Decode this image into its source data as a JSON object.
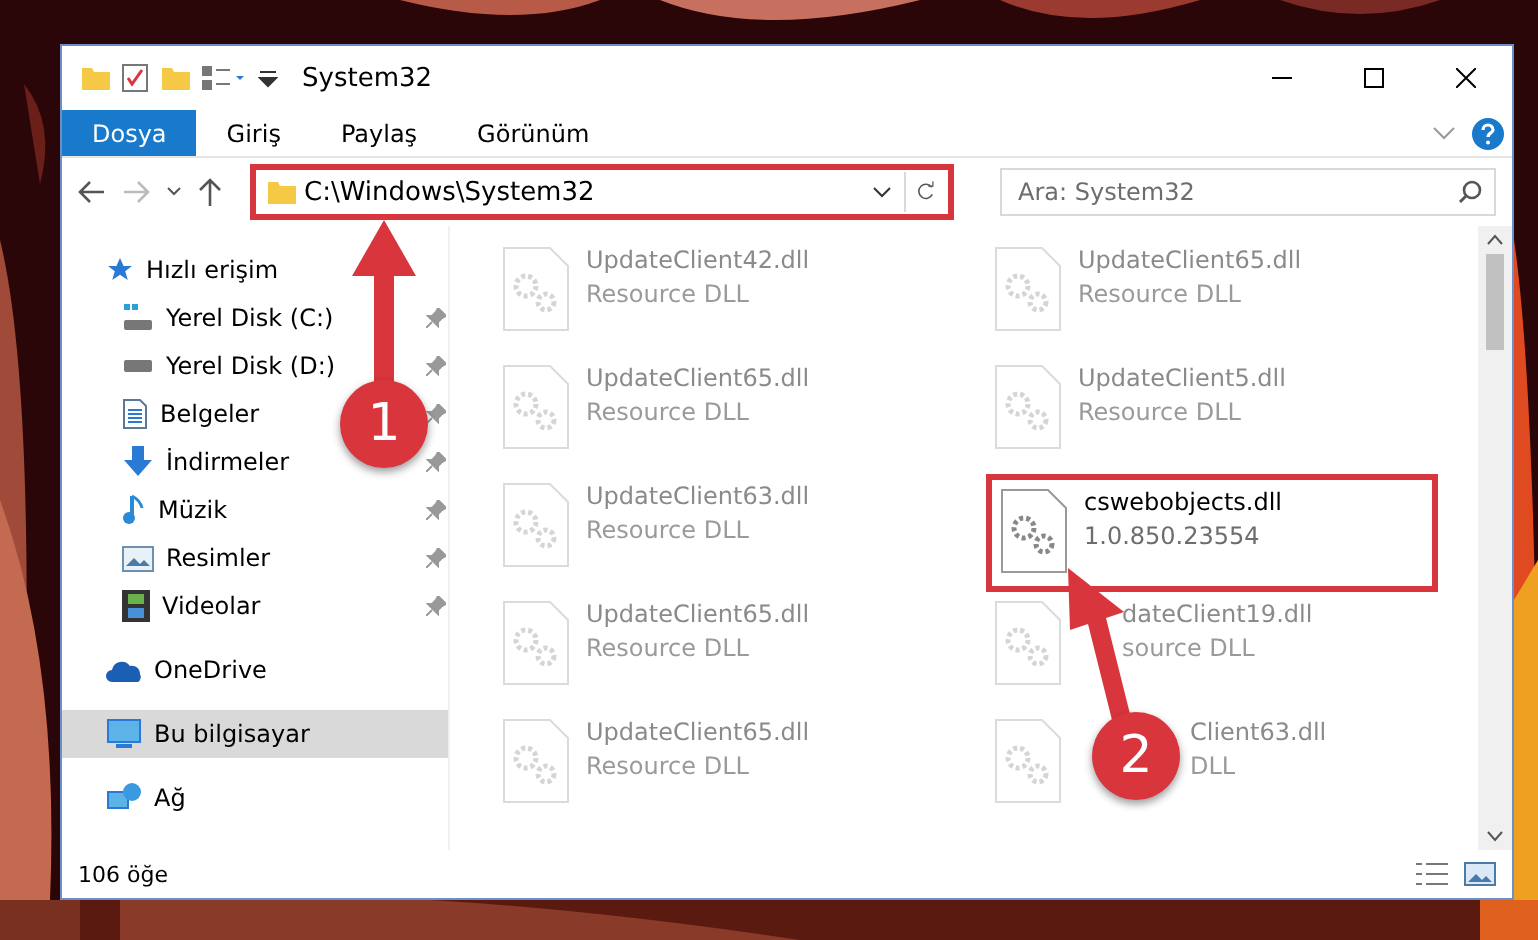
{
  "window": {
    "title": "System32"
  },
  "ribbon": {
    "tabs": [
      {
        "label": "Dosya",
        "selected": true
      },
      {
        "label": "Giriş",
        "selected": false
      },
      {
        "label": "Paylaş",
        "selected": false
      },
      {
        "label": "Görünüm",
        "selected": false
      }
    ]
  },
  "address": {
    "path": "C:\\Windows\\System32",
    "highlighted": true
  },
  "search": {
    "placeholder": "Ara: System32"
  },
  "sidebar": {
    "items": [
      {
        "label": "Hızlı erişim",
        "kind": "star",
        "selected": false,
        "children": [
          {
            "label": "Yerel Disk (C:)",
            "kind": "windisk",
            "pinned": true
          },
          {
            "label": "Yerel Disk (D:)",
            "kind": "disk",
            "pinned": true
          },
          {
            "label": "Belgeler",
            "kind": "doc",
            "pinned": true
          },
          {
            "label": "İndirmeler",
            "kind": "download",
            "pinned": true
          },
          {
            "label": "Müzik",
            "kind": "music",
            "pinned": true
          },
          {
            "label": "Resimler",
            "kind": "pictures",
            "pinned": true
          },
          {
            "label": "Videolar",
            "kind": "video",
            "pinned": true
          }
        ]
      },
      {
        "label": "OneDrive",
        "kind": "cloud",
        "selected": false
      },
      {
        "label": "Bu bilgisayar",
        "kind": "pc",
        "selected": true
      },
      {
        "label": "Ağ",
        "kind": "network",
        "selected": false
      }
    ]
  },
  "files": [
    {
      "name": "UpdateClient42.dll",
      "detail": "Resource DLL",
      "faded": true,
      "highlighted": false
    },
    {
      "name": "UpdateClient65.dll",
      "detail": "Resource DLL",
      "faded": true,
      "highlighted": false
    },
    {
      "name": "UpdateClient65.dll",
      "detail": "Resource DLL",
      "faded": true,
      "highlighted": false
    },
    {
      "name": "UpdateClient5.dll",
      "detail": "Resource DLL",
      "faded": true,
      "highlighted": false
    },
    {
      "name": "UpdateClient63.dll",
      "detail": "Resource DLL",
      "faded": true,
      "highlighted": false
    },
    {
      "name": "cswebobjects.dll",
      "detail": "1.0.850.23554",
      "faded": false,
      "highlighted": true
    },
    {
      "name": "UpdateClient65.dll",
      "detail": "Resource DLL",
      "faded": true,
      "highlighted": false
    },
    {
      "name": "dateClient19.dll",
      "detail": "source DLL",
      "faded": true,
      "highlighted": false
    },
    {
      "name": "UpdateClient65.dll",
      "detail": "Resource DLL",
      "faded": true,
      "highlighted": false
    },
    {
      "name": "Client63.dll",
      "detail": "DLL",
      "faded": true,
      "highlighted": false
    }
  ],
  "status_bar": {
    "count": "106 öğe"
  },
  "annotations": [
    {
      "number": "1"
    },
    {
      "number": "2"
    }
  ]
}
